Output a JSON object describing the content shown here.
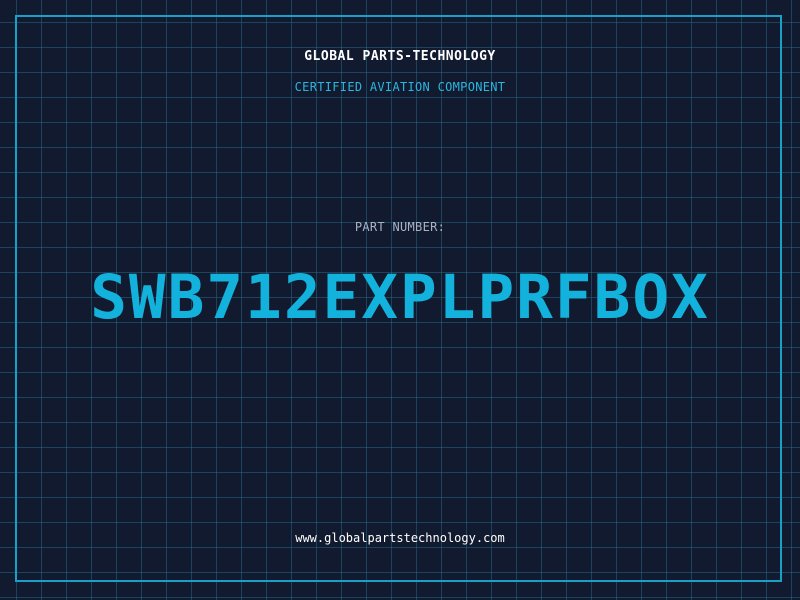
{
  "header": {
    "company": "GLOBAL PARTS-TECHNOLOGY",
    "tagline": "CERTIFIED AVIATION COMPONENT"
  },
  "part": {
    "label": "PART NUMBER:",
    "number": "SWB712EXPLPRFBOX"
  },
  "footer": {
    "website": "www.globalpartstechnology.com"
  },
  "colors": {
    "background": "#111a2e",
    "accent": "#13b2dc",
    "grid": "#287896",
    "text": "#ffffff",
    "muted": "#a9b3c4"
  }
}
